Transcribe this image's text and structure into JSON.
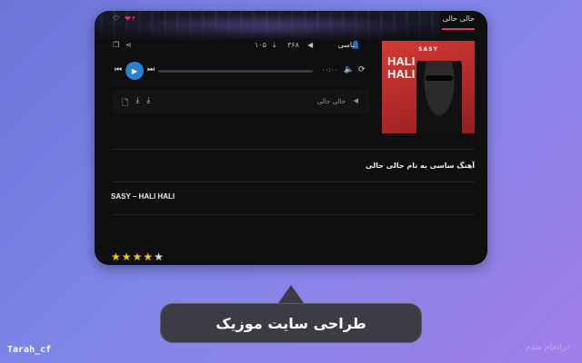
{
  "header": {
    "tab_label": "حالی حالی",
    "like_count": "۴",
    "likes_active_color": "#e0306a"
  },
  "cover": {
    "band_text": "SASY",
    "title_line1": "HALI",
    "title_line2": "HALI"
  },
  "meta": {
    "artist": "ساسی",
    "plays": "۳۶۸",
    "downloads": "۱۰۵"
  },
  "player": {
    "time": "۰۰:۰۰",
    "accent": "#2d7fd0",
    "progress": 0
  },
  "playlist": {
    "track": "حالی حالی"
  },
  "content": {
    "description": "آهنگ ساسی به نام حالی حالی",
    "song_title": "SASY – HALI HALI"
  },
  "rating": {
    "stars_filled": 4,
    "stars_total": 5
  },
  "caption": "طراحی سایت موزیک",
  "footer": {
    "left": "Tarah_cf",
    "right": "درانجام میدم"
  }
}
